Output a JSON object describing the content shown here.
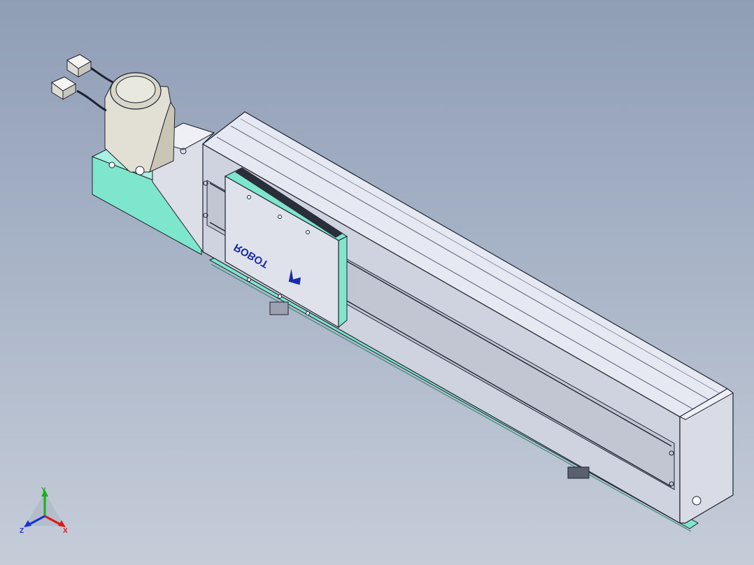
{
  "window": {
    "title": ""
  },
  "model": {
    "brand_label": "ROBOT",
    "colors": {
      "background_top": "#8f9db6",
      "background_bottom": "#c6cdd9",
      "body_light": "#e6e9f2",
      "body_mid": "#cfd3df",
      "body_dark": "#a9aec0",
      "mint": "#7ee6cc",
      "motor": "#e2e0d4",
      "brand_blue": "#1a2aa8",
      "edge": "#1f2230"
    }
  },
  "triad": {
    "x_label": "X",
    "y_label": "Y",
    "z_label": "Z",
    "x_color": "#e01818",
    "y_color": "#18b018",
    "z_color": "#1830d8"
  }
}
